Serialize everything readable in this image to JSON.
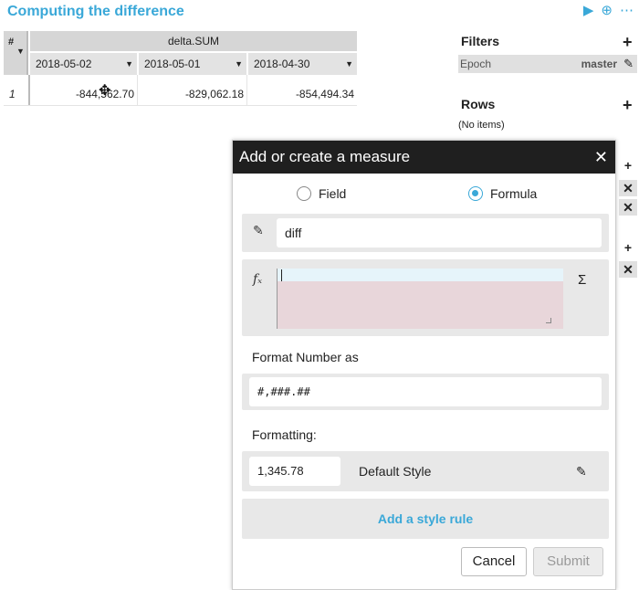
{
  "header": {
    "title": "Computing the difference",
    "icons": [
      "play-icon",
      "zoom-in-icon",
      "more-icon"
    ],
    "play_glyph": "▶",
    "zoom_glyph": "⊕",
    "more_glyph": "⋯"
  },
  "table": {
    "corner_label": "#",
    "corner_arrow": "▼",
    "measure_header": "delta.SUM",
    "columns": [
      {
        "label": "2018-05-02",
        "arrow": "▼"
      },
      {
        "label": "2018-05-01",
        "arrow": "▼"
      },
      {
        "label": "2018-04-30",
        "arrow": "▼"
      }
    ],
    "rows": [
      {
        "index": "1",
        "values": [
          "-844,562.70",
          "-829,062.18",
          "-854,494.34"
        ]
      }
    ]
  },
  "panel": {
    "filters_title": "Filters",
    "plus_glyph": "+",
    "close_glyph": "✕",
    "filter": {
      "name": "Epoch",
      "value": "master",
      "pen": "✎"
    },
    "rows_title": "Rows",
    "rows_empty": "(No items)"
  },
  "modal": {
    "title": "Add or create a measure",
    "close": "✕",
    "radio_field": "Field",
    "radio_formula": "Formula",
    "selected_radio": "formula",
    "name_value": "diff",
    "pen_glyph": "✎",
    "fx_glyph": "fₓ",
    "sigma_glyph": "Σ",
    "formula_value": "",
    "format_label": "Format Number as",
    "format_value": "#,###.##",
    "formatting_label": "Formatting:",
    "sample_value": "1,345.78",
    "style_name": "Default Style",
    "add_rule": "Add a style rule",
    "cancel": "Cancel",
    "submit": "Submit"
  },
  "colors": {
    "accent": "#3aa8d8",
    "modal_header": "#1f1f1f",
    "formula_bg": "#e8d6da"
  }
}
